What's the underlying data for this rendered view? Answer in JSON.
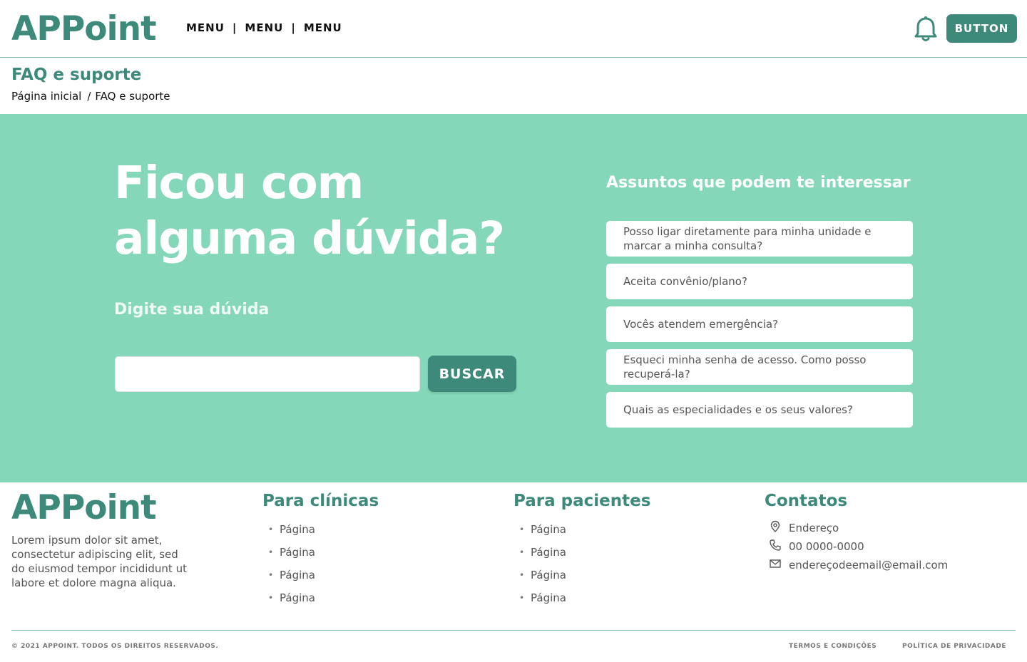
{
  "header": {
    "logo": "APPoint",
    "menu": [
      "MENU",
      "MENU",
      "MENU"
    ],
    "menu_separator": "|",
    "button_label": "BUTTON",
    "bell_icon": "bell-icon"
  },
  "page": {
    "title": "FAQ e suporte",
    "breadcrumb": [
      "Página inicial",
      "FAQ e suporte"
    ],
    "breadcrumb_separator": "/"
  },
  "hero": {
    "title_line1": "Ficou com",
    "title_line2": "alguma dúvida?",
    "search_label": "Digite sua dúvida",
    "search_value": "",
    "search_placeholder": "",
    "search_button": "BUSCAR",
    "topics_title": "Assuntos que podem te interessar",
    "topics": [
      "Posso ligar diretamente para minha unidade e marcar a minha consulta?",
      "Aceita convênio/plano?",
      "Vocês atendem emergência?",
      "Esqueci minha senha de acesso. Como posso recuperá-la?",
      "Quais as especialidades e os seus valores?"
    ]
  },
  "footer": {
    "logo": "APPoint",
    "description": "Lorem ipsum dolor sit amet, consectetur adipiscing elit, sed do eiusmod tempor incididunt ut labore et dolore magna aliqua.",
    "clinics": {
      "title": "Para clínicas",
      "links": [
        "Página",
        "Página",
        "Página",
        "Página"
      ]
    },
    "patients": {
      "title": "Para pacientes",
      "links": [
        "Página",
        "Página",
        "Página",
        "Página"
      ]
    },
    "contacts": {
      "title": "Contatos",
      "address": "Endereço",
      "phone": "00 0000-0000",
      "email": "endereçodeemail@email.com"
    },
    "bullet": "•",
    "copyright": "© 2021 APPOINT. TODOS OS DIREITOS RESERVADOS.",
    "terms": "TERMOS E CONDIÇÕES",
    "privacy": "POLÍTICA DE PRIVACIDADE"
  },
  "colors": {
    "brand": "#3d8a7a",
    "hero_bg": "#85d7b9",
    "white": "#ffffff"
  }
}
